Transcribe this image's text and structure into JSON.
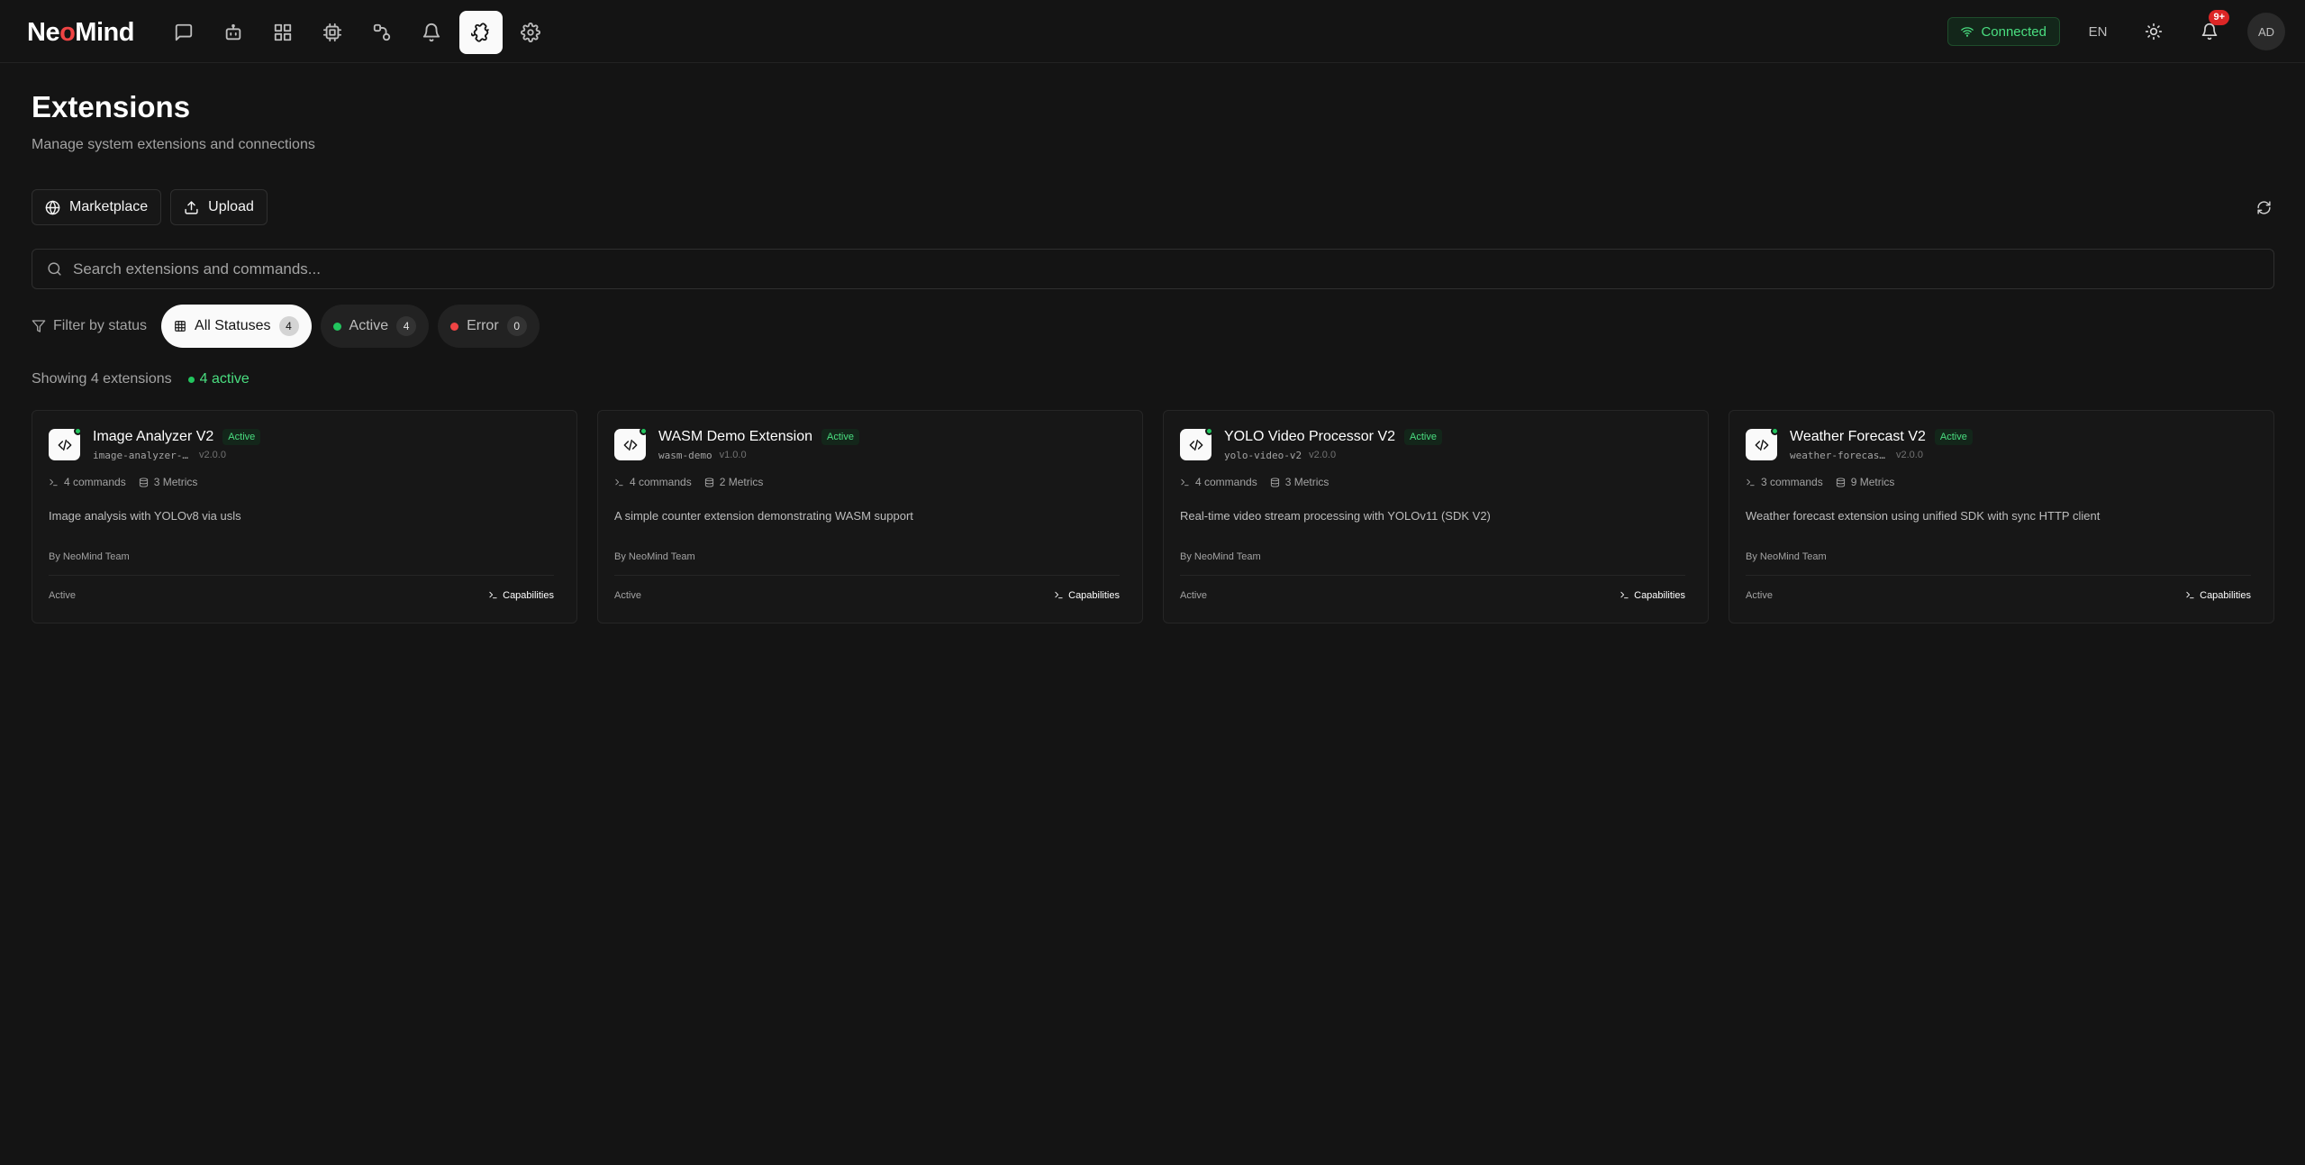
{
  "app": {
    "logo_prefix": "Ne",
    "logo_dot": "o",
    "logo_suffix": "Mind"
  },
  "topbar": {
    "connection_status": "Connected",
    "language": "EN",
    "notification_badge": "9+",
    "avatar_initials": "AD",
    "nav_icons": [
      "chat-icon",
      "bot-icon",
      "dashboard-icon",
      "cpu-icon",
      "automation-icon",
      "bell-icon",
      "extensions-icon",
      "settings-icon"
    ],
    "active_nav": "extensions-icon"
  },
  "page": {
    "title": "Extensions",
    "subtitle": "Manage system extensions and connections"
  },
  "toolbar": {
    "marketplace_label": "Marketplace",
    "upload_label": "Upload"
  },
  "search": {
    "placeholder": "Search extensions and commands...",
    "value": ""
  },
  "filters": {
    "label": "Filter by status",
    "pills": [
      {
        "label": "All Statuses",
        "count": "4",
        "active": true
      },
      {
        "label": "Active",
        "count": "4",
        "color": "#22c55e"
      },
      {
        "label": "Error",
        "count": "0",
        "color": "#ef4444"
      }
    ]
  },
  "summary": {
    "showing": "Showing 4 extensions",
    "active": "4 active"
  },
  "extensions": [
    {
      "name": "Image Analyzer V2",
      "status_tag": "Active",
      "id": "image-analyzer-v2",
      "version": "v2.0.0",
      "commands": "4 commands",
      "metrics": "3 Metrics",
      "description": "Image analysis with YOLOv8 via usls",
      "author": "By NeoMind Team",
      "footer_status": "Active",
      "capabilities_label": "Capabilities"
    },
    {
      "name": "WASM Demo Extension",
      "status_tag": "Active",
      "id": "wasm-demo",
      "version": "v1.0.0",
      "commands": "4 commands",
      "metrics": "2 Metrics",
      "description": "A simple counter extension demonstrating WASM support",
      "author": "By NeoMind Team",
      "footer_status": "Active",
      "capabilities_label": "Capabilities"
    },
    {
      "name": "YOLO Video Processor V2",
      "status_tag": "Active",
      "id": "yolo-video-v2",
      "version": "v2.0.0",
      "commands": "4 commands",
      "metrics": "3 Metrics",
      "description": "Real-time video stream processing with YOLOv11 (SDK V2)",
      "author": "By NeoMind Team",
      "footer_status": "Active",
      "capabilities_label": "Capabilities"
    },
    {
      "name": "Weather Forecast V2",
      "status_tag": "Active",
      "id": "weather-forecast-v2",
      "version": "v2.0.0",
      "commands": "3 commands",
      "metrics": "9 Metrics",
      "description": "Weather forecast extension using unified SDK with sync HTTP client",
      "author": "By NeoMind Team",
      "footer_status": "Active",
      "capabilities_label": "Capabilities"
    }
  ]
}
